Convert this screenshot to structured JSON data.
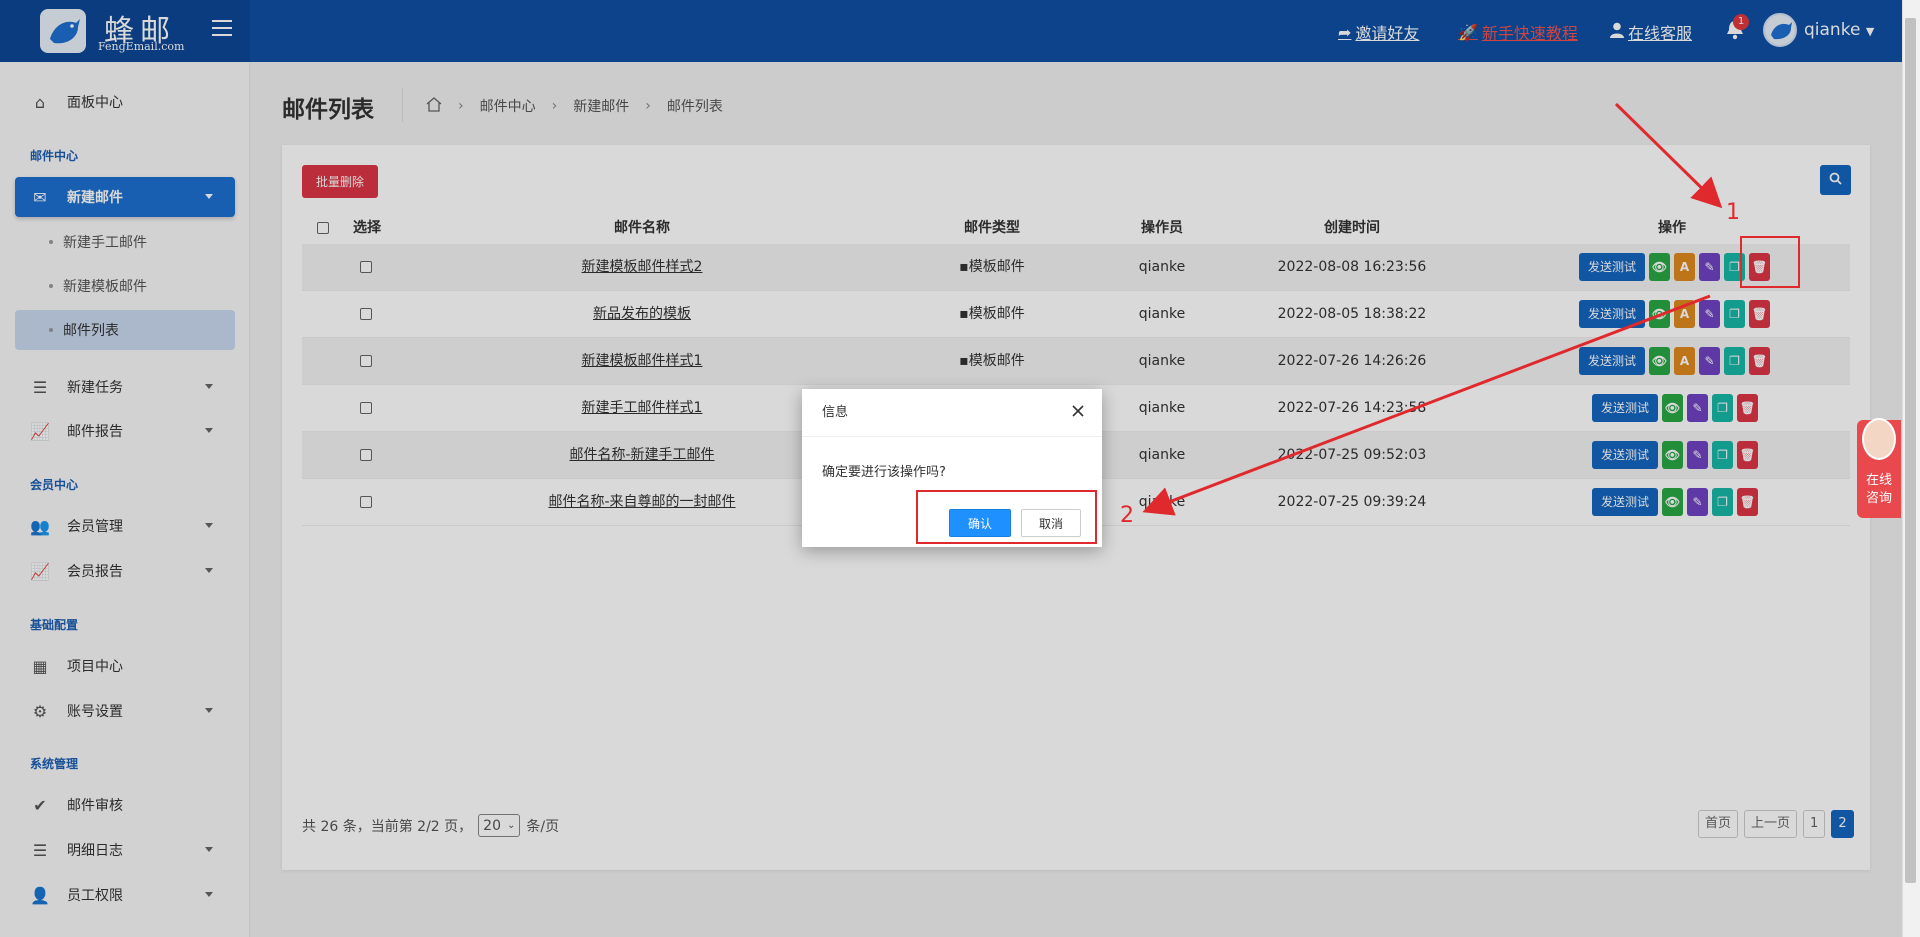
{
  "brand": {
    "name": "蜂邮",
    "subtitle": "FengEmail.com"
  },
  "topbar": {
    "invite": "邀请好友",
    "tutorial": "新手快速教程",
    "support": "在线客服",
    "notification_count": "1",
    "username": "qianke"
  },
  "sidebar": {
    "dashboard": "面板中心",
    "section_mail": "邮件中心",
    "new_mail": "新建邮件",
    "sub_manual": "新建手工邮件",
    "sub_template": "新建模板邮件",
    "sub_list": "邮件列表",
    "new_task": "新建任务",
    "mail_report": "邮件报告",
    "section_member": "会员中心",
    "member_manage": "会员管理",
    "member_report": "会员报告",
    "section_config": "基础配置",
    "project_center": "项目中心",
    "account_settings": "账号设置",
    "section_system": "系统管理",
    "mail_review": "邮件审核",
    "detail_log": "明细日志",
    "staff_permission": "员工权限"
  },
  "page": {
    "title": "邮件列表",
    "breadcrumb": [
      "邮件中心",
      "新建邮件",
      "邮件列表"
    ]
  },
  "toolbar": {
    "batch_delete": "批量删除"
  },
  "table": {
    "headers": {
      "select": "选择",
      "name": "邮件名称",
      "type": "邮件类型",
      "operator": "操作员",
      "created": "创建时间",
      "actions": "操作"
    },
    "send_test_label": "发送测试",
    "rows": [
      {
        "name": "新建模板邮件样式2",
        "type": "模板邮件",
        "operator": "qianke",
        "created": "2022-08-08 16:23:56"
      },
      {
        "name": "新品发布的模板",
        "type": "模板邮件",
        "operator": "qianke",
        "created": "2022-08-05 18:38:22"
      },
      {
        "name": "新建模板邮件样式1",
        "type": "模板邮件",
        "operator": "qianke",
        "created": "2022-07-26 14:26:26"
      },
      {
        "name": "新建手工邮件样式1",
        "type": "",
        "operator": "qianke",
        "created": "2022-07-26 14:23:58"
      },
      {
        "name": "邮件名称-新建手工邮件",
        "type": "",
        "operator": "qianke",
        "created": "2022-07-25 09:52:03"
      },
      {
        "name": "邮件名称-来自尊邮的一封邮件",
        "type": "",
        "operator": "qianke",
        "created": "2022-07-25 09:39:24"
      }
    ]
  },
  "pagination": {
    "summary": "共 26 条，当前第 2/2 页，",
    "page_size": "20",
    "per_page_suffix": "条/页",
    "first": "首页",
    "prev": "上一页",
    "pages": [
      "1",
      "2"
    ],
    "current": "2"
  },
  "dialog": {
    "title": "信息",
    "message": "确定要进行该操作吗?",
    "confirm": "确认",
    "cancel": "取消"
  },
  "annotations": {
    "step1": "1",
    "step2": "2"
  },
  "chat_widget": {
    "line1": "在线",
    "line2": "咨询"
  },
  "colors": {
    "primary": "#1565c0",
    "topbar": "#0f4fa3",
    "danger": "#dc3545",
    "annotation": "#e0292d"
  }
}
